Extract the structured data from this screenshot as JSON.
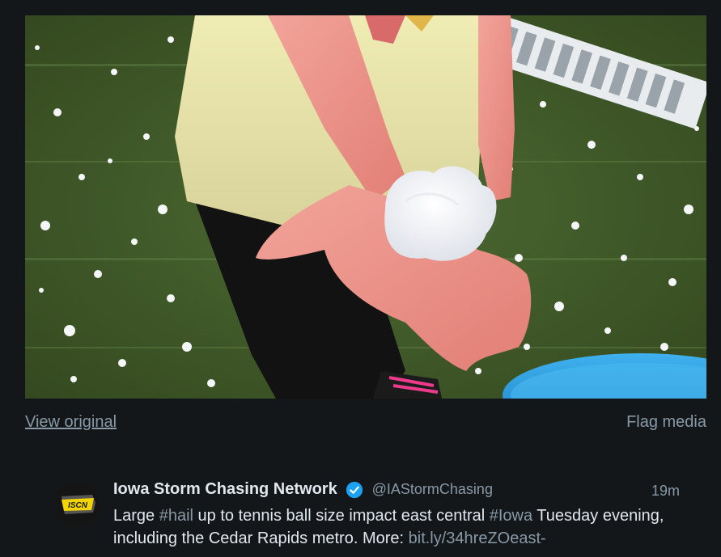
{
  "media": {
    "alt_description": "",
    "view_original_label": "View original",
    "flag_media_label": "Flag media"
  },
  "tweet": {
    "avatar_text": "ISCN",
    "display_name": "Iowa Storm Chasing Network",
    "handle": "@IAStormChasing",
    "timestamp": "19m",
    "text_segments": {
      "t1": "Large ",
      "h1": "#hail",
      "t2": " up to tennis ball size impact east central ",
      "h2": "#Iowa",
      "t3": " Tuesday evening, including the Cedar Rapids metro. More: ",
      "link": "bit.ly/34hreZOeast-"
    }
  },
  "colors": {
    "background": "#14171a",
    "primary_text": "#e1e8ed",
    "secondary_text": "#8899a6",
    "verified_badge": "#1da1f2"
  }
}
